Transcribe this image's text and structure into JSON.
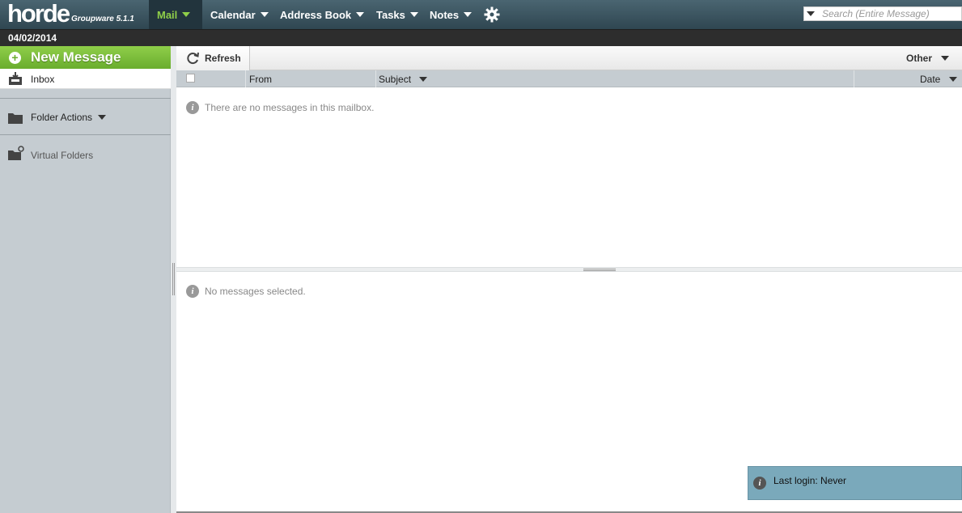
{
  "header": {
    "logo_text": "horde",
    "version_text": "Groupware 5.1.1",
    "nav": [
      {
        "label": "Mail",
        "active": true
      },
      {
        "label": "Calendar",
        "active": false
      },
      {
        "label": "Address Book",
        "active": false
      },
      {
        "label": "Tasks",
        "active": false
      },
      {
        "label": "Notes",
        "active": false
      }
    ],
    "settings_icon": "gear-icon",
    "search": {
      "placeholder": "Search (Entire Message)"
    }
  },
  "datebar": {
    "date": "04/02/2014"
  },
  "sidebar": {
    "new_message": "New Message",
    "inbox": "Inbox",
    "folder_actions": "Folder Actions",
    "virtual_folders": "Virtual Folders"
  },
  "toolbar": {
    "refresh": "Refresh",
    "other": "Other"
  },
  "columns": {
    "from": "From",
    "subject": "Subject",
    "date": "Date"
  },
  "list": {
    "empty_text": "There are no messages in this mailbox."
  },
  "preview": {
    "empty_text": "No messages selected."
  },
  "notification": {
    "text": "Last login: Never"
  },
  "colors": {
    "accent_green": "#8fce49",
    "topbar": "#3b5461",
    "sidebar": "#c5ccd1",
    "notification": "#7aa9bb"
  }
}
